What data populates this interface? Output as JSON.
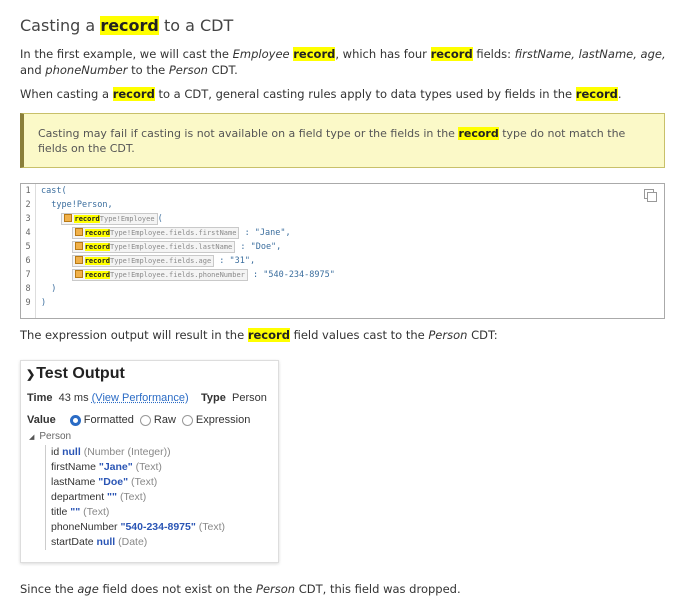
{
  "heading": {
    "pre": "Casting a ",
    "hl": "record",
    "post": " to a CDT"
  },
  "para1": {
    "a": "In the first example, we will cast the ",
    "b": "Employee",
    "c": " ",
    "d": "record",
    "e": ", which has four ",
    "f": "record",
    "g": " fields: ",
    "h": "firstName, lastName, age,",
    "i": " and ",
    "j": "phoneNumber",
    "k": " to the ",
    "l": "Person",
    "m": " CDT."
  },
  "para2": {
    "a": "When casting a ",
    "b": "record",
    "c": " to a CDT, general casting rules apply to data types used by fields in the ",
    "d": "record",
    "e": "."
  },
  "note": {
    "a": "Casting may fail if casting is not available on a field type or the fields in the ",
    "b": "record",
    "c": " type do not match the fields on the CDT."
  },
  "code": {
    "line_numbers": [
      "1",
      "2",
      "3",
      "4",
      "5",
      "6",
      "7",
      "8",
      "9"
    ],
    "l1": "cast(",
    "l2": "  type!Person,",
    "l3_hl": "record",
    "l3_rest": "Type!Employee",
    "l3_tail": "(",
    "fields": [
      {
        "hl": "record",
        "rest": "Type!Employee.fields.firstName",
        "value": " : \"Jane\","
      },
      {
        "hl": "record",
        "rest": "Type!Employee.fields.lastName",
        "value": " : \"Doe\","
      },
      {
        "hl": "record",
        "rest": "Type!Employee.fields.age",
        "value": " : \"31\","
      },
      {
        "hl": "record",
        "rest": "Type!Employee.fields.phoneNumber",
        "value": " : \"540-234-8975\""
      }
    ],
    "l8": "  )",
    "l9": ")"
  },
  "para3": {
    "a": "The expression output will result in the ",
    "b": "record",
    "c": " field values cast to the ",
    "d": "Person",
    "e": " CDT:"
  },
  "test_output": {
    "title": "Test Output",
    "time_label": "Time",
    "time_value": "43 ms",
    "perf_link": "(View Performance)",
    "type_label": "Type",
    "type_value": "Person",
    "value_label": "Value",
    "options": [
      "Formatted",
      "Raw",
      "Expression"
    ],
    "selected": "Formatted",
    "root": "Person",
    "fields": [
      {
        "name": "id",
        "value": "null",
        "type": "(Number (Integer))"
      },
      {
        "name": "firstName",
        "value": "\"Jane\"",
        "type": "(Text)"
      },
      {
        "name": "lastName",
        "value": "\"Doe\"",
        "type": "(Text)"
      },
      {
        "name": "department",
        "value": "\"\"",
        "type": "(Text)"
      },
      {
        "name": "title",
        "value": "\"\"",
        "type": "(Text)"
      },
      {
        "name": "phoneNumber",
        "value": "\"540-234-8975\"",
        "type": "(Text)"
      },
      {
        "name": "startDate",
        "value": "null",
        "type": "(Date)"
      }
    ]
  },
  "para4": {
    "a": "Since the ",
    "b": "age",
    "c": " field does not exist on the ",
    "d": "Person",
    "e": " CDT, this field was dropped."
  }
}
